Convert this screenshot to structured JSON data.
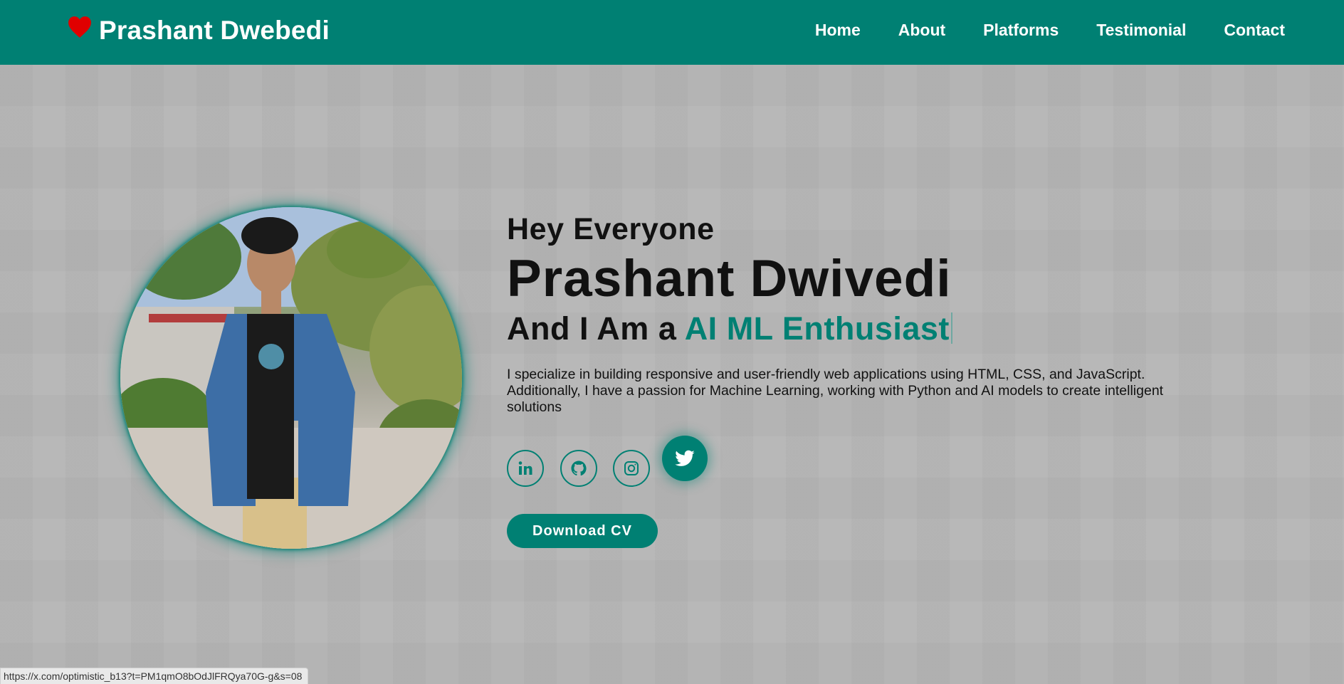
{
  "header": {
    "brand": "Prashant Dwebedi",
    "nav": [
      "Home",
      "About",
      "Platforms",
      "Testimonial",
      "Contact"
    ]
  },
  "hero": {
    "greeting": "Hey Everyone",
    "name": "Prashant Dwivedi",
    "role_prefix": "And I Am a ",
    "role_typed": "AI ML Enthusiast",
    "bio": "I specialize in building responsive and user-friendly web applications using HTML, CSS, and JavaScript. Additionally, I have a passion for Machine Learning, working with Python and AI models to create intelligent solutions",
    "download_button": "Download CV"
  },
  "socials": [
    {
      "icon": "linkedin-icon"
    },
    {
      "icon": "github-icon"
    },
    {
      "icon": "instagram-icon"
    },
    {
      "icon": "twitter-icon"
    }
  ],
  "status_bar": {
    "url": "https://x.com/optimistic_b13?t=PM1qmO8bOdJlFRQya70G-g&s=08"
  },
  "colors": {
    "accent": "#008073",
    "header_bg": "#008073",
    "heart": "#e00000",
    "page_bg": "#b6b6b6"
  }
}
